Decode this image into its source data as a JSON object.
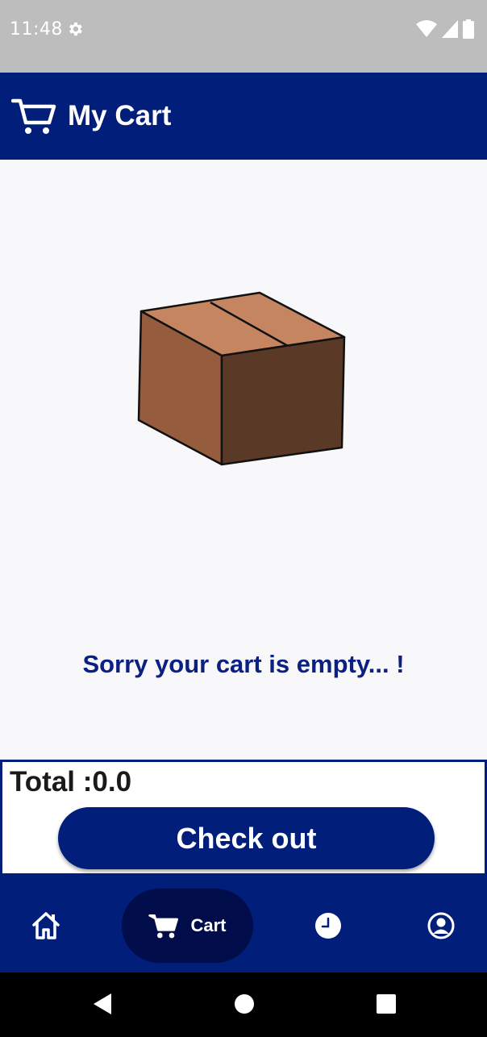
{
  "status_bar": {
    "time": "11:48",
    "icons": [
      "gear-icon",
      "wifi-icon",
      "signal-icon",
      "battery-icon"
    ]
  },
  "app_bar": {
    "title": "My Cart",
    "icon": "cart-icon",
    "background_color": "#011e7a"
  },
  "main": {
    "illustration": "empty-box-illustration",
    "empty_message": "Sorry your cart is empty... !"
  },
  "total_panel": {
    "total_text": "Total :0.0",
    "checkout_label": "Check out"
  },
  "bottom_nav": {
    "items": [
      {
        "id": "home",
        "icon": "home-icon",
        "label": ""
      },
      {
        "id": "cart",
        "icon": "cart-icon",
        "label": "Cart",
        "active": true
      },
      {
        "id": "history",
        "icon": "clock-icon",
        "label": ""
      },
      {
        "id": "profile",
        "icon": "account-icon",
        "label": ""
      }
    ],
    "active_pill_color": "#000d4a"
  },
  "system_nav": {
    "buttons": [
      "back-icon",
      "home-circle-icon",
      "recents-icon"
    ]
  },
  "colors": {
    "primary": "#011e7a",
    "message_text": "#0b2080",
    "status_bar": "#bdbdbd"
  }
}
